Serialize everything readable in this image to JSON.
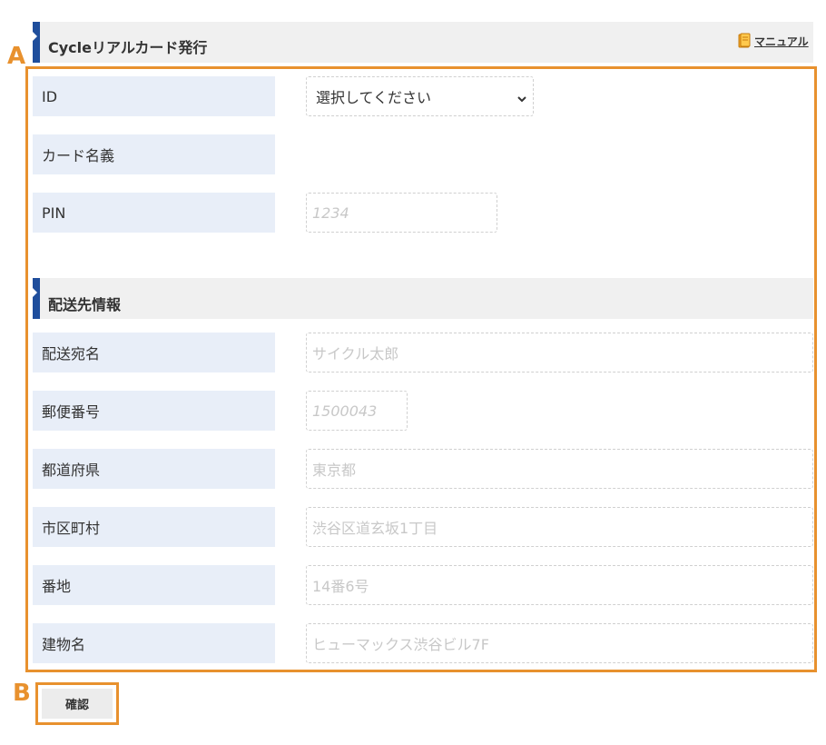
{
  "header": {
    "title": "Cycleリアルカード発行",
    "manual_label": "マニュアル"
  },
  "card_section": {
    "fields": [
      {
        "label": "ID",
        "type": "select",
        "value": "選択してください"
      },
      {
        "label": "カード名義",
        "type": "text",
        "value": ""
      },
      {
        "label": "PIN",
        "type": "input",
        "placeholder": "1234"
      }
    ]
  },
  "shipping_section": {
    "title": "配送先情報",
    "fields": [
      {
        "label": "配送宛名",
        "placeholder": "サイクル太郎"
      },
      {
        "label": "郵便番号",
        "placeholder": "1500043"
      },
      {
        "label": "都道府県",
        "placeholder": "東京都"
      },
      {
        "label": "市区町村",
        "placeholder": "渋谷区道玄坂1丁目"
      },
      {
        "label": "番地",
        "placeholder": "14番6号"
      },
      {
        "label": "建物名",
        "placeholder": "ヒューマックス渋谷ビル7F"
      }
    ]
  },
  "confirm_button": {
    "label": "確認"
  },
  "annotations": {
    "a": "A",
    "b": "B"
  },
  "colors": {
    "accent_bar": "#1f4e9c",
    "label_bg": "#e8eef8",
    "annotation": "#e8912e"
  }
}
